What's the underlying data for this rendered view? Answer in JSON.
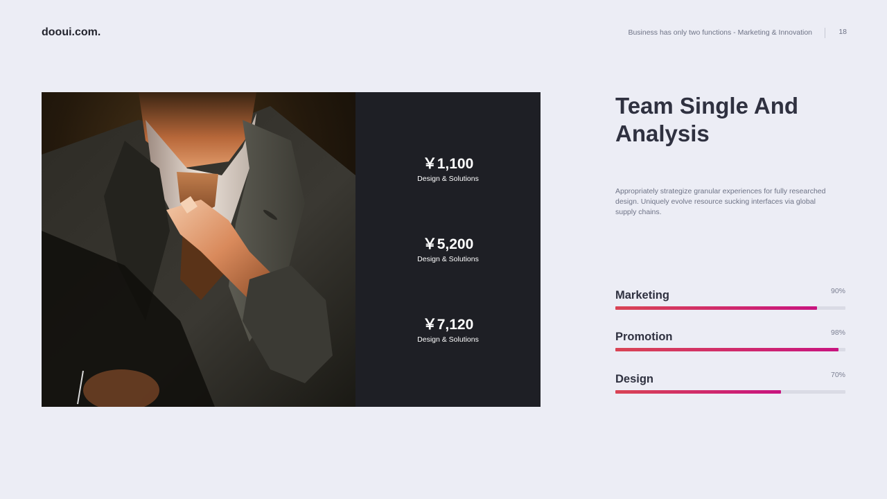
{
  "header": {
    "brand": "dooui.com.",
    "tagline": "Business has only two functions - Marketing & Innovation",
    "page_number": "18"
  },
  "stats": [
    {
      "value": "￥1,100",
      "label": "Design & Solutions"
    },
    {
      "value": "￥5,200",
      "label": "Design & Solutions"
    },
    {
      "value": "￥7,120",
      "label": "Design & Solutions"
    }
  ],
  "content": {
    "title": "Team Single And Analysis",
    "description": "Appropriately strategize granular experiences for fully researched design. Uniquely  evolve resource sucking interfaces via global supply chains."
  },
  "skills": [
    {
      "name": "Marketing",
      "percent_label": "90%",
      "value": 0.875
    },
    {
      "name": "Promotion",
      "percent_label": "98%",
      "value": 0.97
    },
    {
      "name": "Design",
      "percent_label": "70%",
      "value": 0.72
    }
  ],
  "colors": {
    "background": "#ECEDF5",
    "dark_panel": "#1E1F25",
    "bar_gradient_start": "#D94454",
    "bar_gradient_end": "#C8147F",
    "bar_track": "#DADBE5"
  }
}
